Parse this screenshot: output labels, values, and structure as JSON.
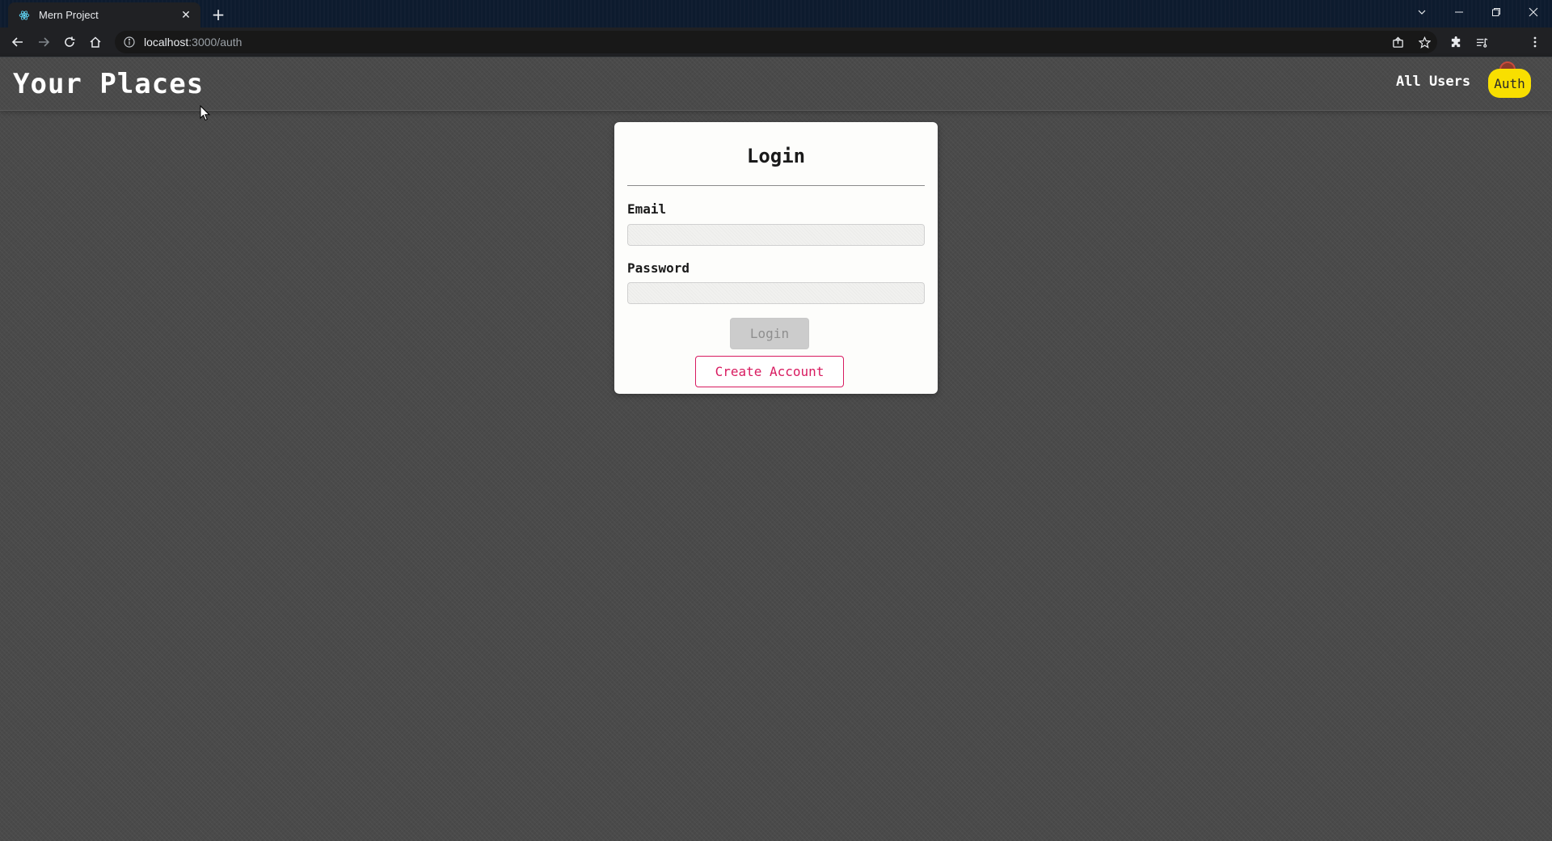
{
  "browser": {
    "tab_title": "Mern Project",
    "tab_close": "✕",
    "new_tab": "+",
    "url_host": "localhost",
    "url_path": ":3000/auth",
    "tab_favicon": "react-icon"
  },
  "header": {
    "brand": "Your Places",
    "nav": {
      "all_users": "All Users",
      "auth": "Auth"
    },
    "auth_active_color": "#f8df00"
  },
  "login_card": {
    "title": "Login",
    "email_label": "Email",
    "email_value": "",
    "password_label": "Password",
    "password_value": "",
    "login_button": "Login",
    "login_button_state": "disabled",
    "create_account_button": "Create Account",
    "accent_color": "#d81b60"
  }
}
